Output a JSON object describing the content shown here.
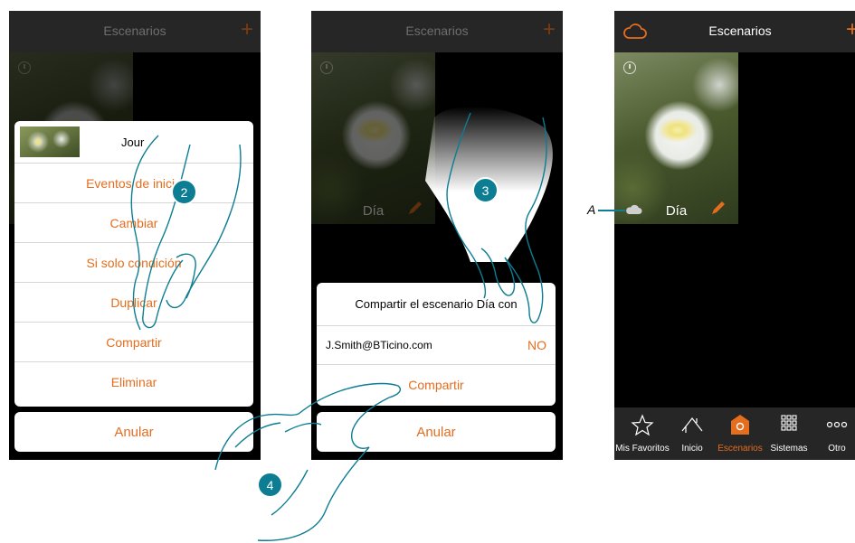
{
  "screen1": {
    "title": "Escenarios",
    "menu": {
      "scenario_name": "Jour",
      "items": [
        "Eventos de inicio",
        "Cambiar",
        "Si solo condición",
        "Duplicar",
        "Compartir",
        "Eliminar"
      ]
    },
    "cancel_label": "Anular"
  },
  "screen2": {
    "title": "Escenarios",
    "tile_name": "Día",
    "share_dialog": {
      "title": "Compartir el escenario Día con",
      "email": "J.Smith@BTicino.com",
      "toggle": "NO",
      "share_button": "Compartir"
    },
    "cancel_label": "Anular"
  },
  "screen3": {
    "title": "Escenarios",
    "tile_name": "Día",
    "tabs": [
      "Mis Favoritos",
      "Inicio",
      "Escenarios",
      "Sistemas",
      "Otro"
    ],
    "active_tab": "Escenarios"
  },
  "annotations": {
    "step2": "2",
    "step3": "3",
    "step4": "4",
    "label_a": "A"
  },
  "colors": {
    "accent": "#e56d1e",
    "step_badge": "#0c7d92",
    "topbar": "#262626"
  }
}
